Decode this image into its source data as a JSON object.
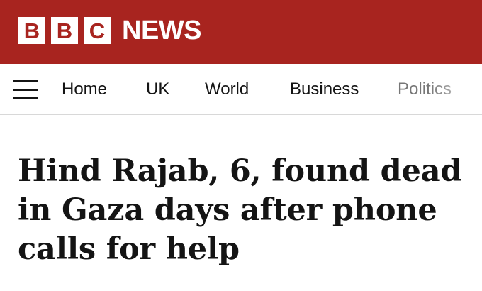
{
  "header": {
    "logo_letters": [
      "B",
      "B",
      "C"
    ],
    "section_name": "NEWS",
    "background_color": "#a8241f"
  },
  "navigation": {
    "menu_icon": "hamburger-menu-icon",
    "items": [
      "Home",
      "UK",
      "World",
      "Business",
      "Politics"
    ]
  },
  "article": {
    "headline": "Hind Rajab, 6, found dead in Gaza days after phone calls for help"
  }
}
